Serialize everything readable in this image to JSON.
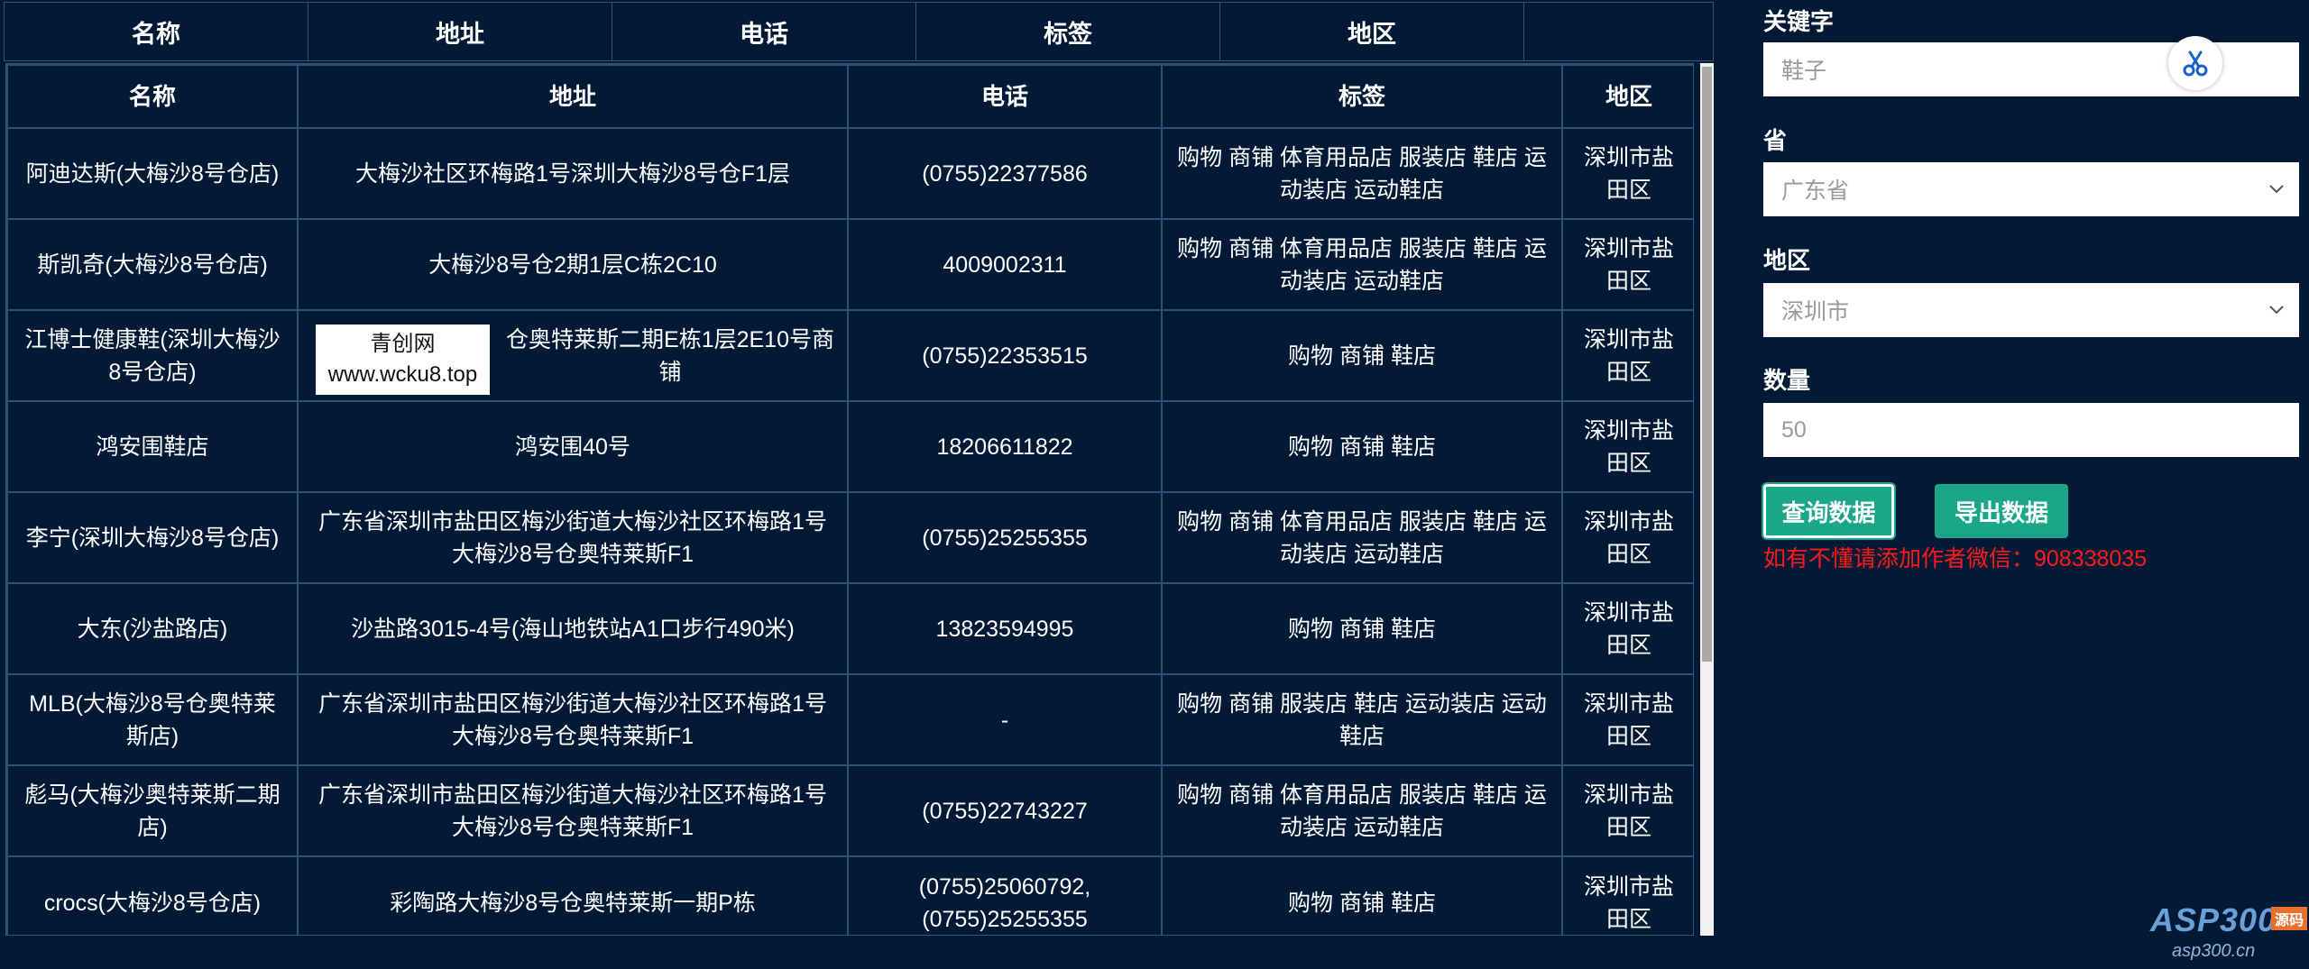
{
  "outer_header": [
    "名称",
    "地址",
    "电话",
    "标签",
    "地区"
  ],
  "table": {
    "columns": [
      "名称",
      "地址",
      "电话",
      "标签",
      "地区"
    ],
    "rows": [
      [
        "阿迪达斯(大梅沙8号仓店)",
        "大梅沙社区环梅路1号深圳大梅沙8号仓F1层",
        "(0755)22377586",
        "购物 商铺 体育用品店 服装店 鞋店 运动装店 运动鞋店",
        "深圳市盐田区"
      ],
      [
        "斯凯奇(大梅沙8号仓店)",
        "大梅沙8号仓2期1层C栋2C10",
        "4009002311",
        "购物 商铺 体育用品店 服装店 鞋店 运动装店 运动鞋店",
        "深圳市盐田区"
      ],
      [
        "江博士健康鞋(深圳大梅沙8号仓店)",
        "仓奥特莱斯二期E栋1层2E10号商铺",
        "(0755)22353515",
        "购物 商铺 鞋店",
        "深圳市盐田区"
      ],
      [
        "鸿安围鞋店",
        "鸿安围40号",
        "18206611822",
        "购物 商铺 鞋店",
        "深圳市盐田区"
      ],
      [
        "李宁(深圳大梅沙8号仓店)",
        "广东省深圳市盐田区梅沙街道大梅沙社区环梅路1号大梅沙8号仓奥特莱斯F1",
        "(0755)25255355",
        "购物 商铺 体育用品店 服装店 鞋店 运动装店 运动鞋店",
        "深圳市盐田区"
      ],
      [
        "大东(沙盐路店)",
        "沙盐路3015-4号(海山地铁站A1口步行490米)",
        "13823594995",
        "购物 商铺 鞋店",
        "深圳市盐田区"
      ],
      [
        "MLB(大梅沙8号仓奥特莱斯店)",
        "广东省深圳市盐田区梅沙街道大梅沙社区环梅路1号大梅沙8号仓奥特莱斯F1",
        "-",
        "购物 商铺 服装店 鞋店 运动装店 运动鞋店",
        "深圳市盐田区"
      ],
      [
        "彪马(大梅沙奥特莱斯二期店)",
        "广东省深圳市盐田区梅沙街道大梅沙社区环梅路1号大梅沙8号仓奥特莱斯F1",
        "(0755)22743227",
        "购物 商铺 体育用品店 服装店 鞋店 运动装店 运动鞋店",
        "深圳市盐田区"
      ],
      [
        "crocs(大梅沙8号仓店)",
        "彩陶路大梅沙8号仓奥特莱斯一期P栋",
        "(0755)25060792,(0755)25255355",
        "购物 商铺 鞋店",
        "深圳市盐田区"
      ]
    ]
  },
  "watermark": {
    "line1": "青创网",
    "line2": "www.wcku8.top"
  },
  "form": {
    "keyword_label": "关键字",
    "keyword_value": "鞋子",
    "province_label": "省",
    "province_value": "广东省",
    "region_label": "地区",
    "region_value": "深圳市",
    "count_label": "数量",
    "count_value": "50",
    "query_button": "查询数据",
    "export_button": "导出数据",
    "notice": "如有不懂请添加作者微信：908338035"
  },
  "logo": {
    "main": "ASP300",
    "tag": "源码",
    "sub": "asp300.cn"
  },
  "colors": {
    "background": "#031a36",
    "button": "#1aa789",
    "notice": "#ff1a1a",
    "border": "#2f4f74"
  },
  "icons": {
    "tool_button": "scissors-icon",
    "select_arrow": "chevron-down-icon"
  }
}
